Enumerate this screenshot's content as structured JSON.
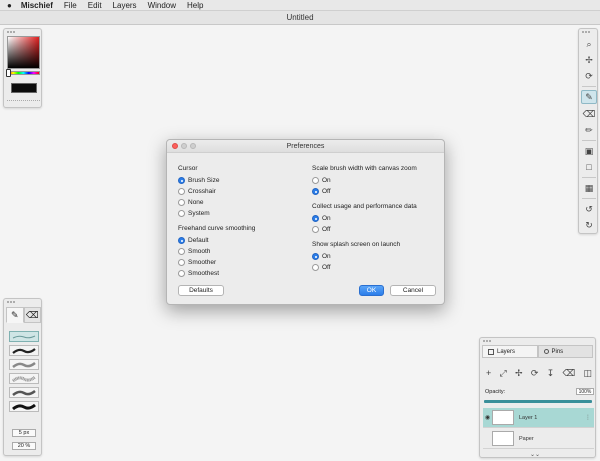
{
  "menubar": {
    "apple": "",
    "items": [
      "Mischief",
      "File",
      "Edit",
      "Layers",
      "Window",
      "Help"
    ]
  },
  "window": {
    "title": "Untitled"
  },
  "colors": {
    "accent": "#2b7de9",
    "layer_selected": "#a8d8d4",
    "swatch": "#0c0c0c",
    "close": "#fc605c"
  },
  "tools": [
    "search-icon",
    "move-icon",
    "rotate-icon",
    "brush-icon",
    "eraser-icon",
    "pencil-icon",
    "paint-icon",
    "rectangle-select-icon",
    "square-icon",
    "image-icon",
    "undo-icon",
    "redo-icon"
  ],
  "brush_panel": {
    "size_value": "5 px",
    "opacity_value": "20 %"
  },
  "layers_panel": {
    "tabs": [
      "Layers",
      "Pins"
    ],
    "opacity_label": "Opacity:",
    "opacity_value": "100%",
    "opacity_fraction": 1.0,
    "layers": [
      {
        "name": "Layer 1",
        "selected": true
      },
      {
        "name": "Paper",
        "selected": false
      }
    ]
  },
  "dialog": {
    "title": "Preferences",
    "cursor": {
      "label": "Cursor",
      "options": [
        "Brush Size",
        "Crosshair",
        "None",
        "System"
      ],
      "selected": "Brush Size"
    },
    "smoothing": {
      "label": "Freehand curve smoothing",
      "options": [
        "Default",
        "Smooth",
        "Smoother",
        "Smoothest"
      ],
      "selected": "Default"
    },
    "scale_brush": {
      "label": "Scale brush width with canvas zoom",
      "options": [
        "On",
        "Off"
      ],
      "selected": "Off"
    },
    "usage": {
      "label": "Collect usage and performance data",
      "options": [
        "On",
        "Off"
      ],
      "selected": "On"
    },
    "splash": {
      "label": "Show splash screen on launch",
      "options": [
        "On",
        "Off"
      ],
      "selected": "On"
    },
    "defaults_label": "Defaults",
    "ok_label": "OK",
    "cancel_label": "Cancel"
  }
}
